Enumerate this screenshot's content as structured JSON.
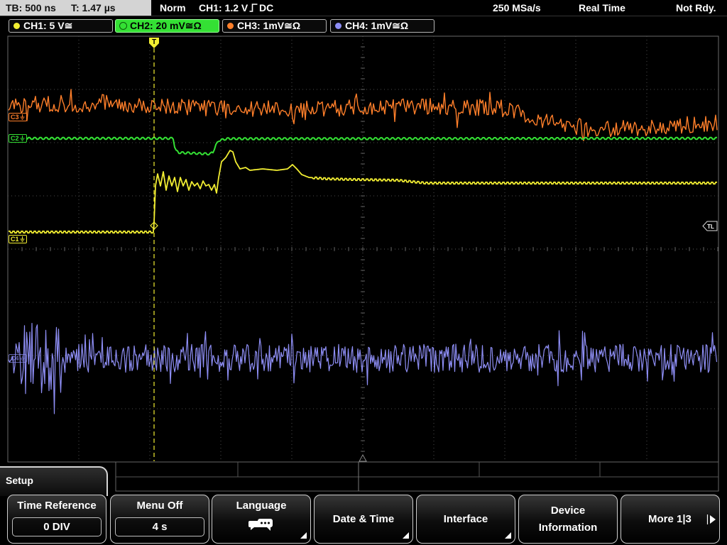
{
  "status_bar": {
    "timebase": "TB: 500 ns",
    "trigger_time": "T: 1.47 µs",
    "trigger_mode": "Norm",
    "trigger_level": "CH1: 1.2 V",
    "trigger_slope_icon": "rising-edge-icon",
    "trigger_coupling": "DC",
    "sample_rate": "250 MSa/s",
    "acquisition_mode": "Real Time",
    "state": "Not Rdy."
  },
  "channels": [
    {
      "button_label": "CH1: 5 V≅",
      "marker": "C1",
      "color": "#f2ee32",
      "active": false
    },
    {
      "button_label": "CH2: 20 mV≅Ω",
      "marker": "C2",
      "color": "#34e034",
      "active": true
    },
    {
      "button_label": "CH3: 1mV≅Ω",
      "marker": "C3",
      "color": "#ff7f2a",
      "active": false
    },
    {
      "button_label": "CH4: 1mV≅Ω",
      "marker": "C4",
      "color": "#8e8ef5",
      "active": false
    }
  ],
  "trigger_markers": {
    "position_label": "T",
    "level_label": "TL"
  },
  "menu": {
    "title": "Setup",
    "softkeys": [
      {
        "label": "Time Reference",
        "value": "0 DIV"
      },
      {
        "label": "Menu Off",
        "value": "4 s"
      },
      {
        "label": "Language",
        "icon": "speech-bubbles-icon",
        "submenu": true
      },
      {
        "label": "Date & Time",
        "submenu": true
      },
      {
        "label": "Interface",
        "submenu": true
      },
      {
        "label": "Device Information"
      },
      {
        "label": "More 1|3",
        "icon": "next-page-arrow-icon"
      }
    ]
  },
  "colors": {
    "status_box_bg": "#d4d4d4",
    "active_channel_bg": "#34e034",
    "grid": "#4d4d4d",
    "softkey_border": "#cfcfcf"
  }
}
